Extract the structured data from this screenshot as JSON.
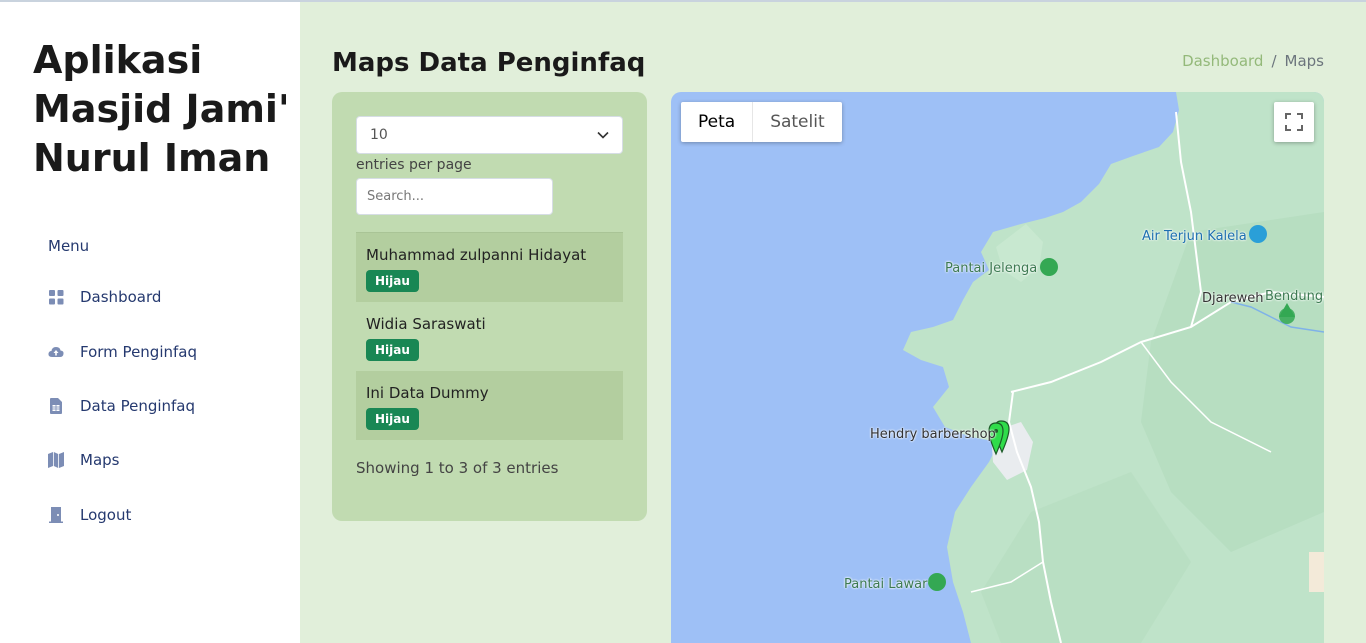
{
  "sidebar": {
    "app_title": "Aplikasi Masjid Jami' Nurul Iman",
    "menu_title": "Menu",
    "items": [
      {
        "label": "Dashboard",
        "icon": "grid-icon"
      },
      {
        "label": "Form Penginfaq",
        "icon": "cloud-upload-icon"
      },
      {
        "label": "Data Penginfaq",
        "icon": "spreadsheet-icon"
      },
      {
        "label": "Maps",
        "icon": "map-icon"
      },
      {
        "label": "Logout",
        "icon": "door-icon"
      }
    ]
  },
  "header": {
    "title": "Maps Data Penginfaq",
    "breadcrumb": [
      "Dashboard",
      "Maps"
    ],
    "breadcrumb_sep": "/"
  },
  "table": {
    "per_page_value": "10",
    "per_page_label": "entries per page",
    "search_placeholder": "Search...",
    "rows": [
      {
        "name": "Muhammad zulpanni Hidayat",
        "badge": "Hijau"
      },
      {
        "name": "Widia Saraswati",
        "badge": "Hijau"
      },
      {
        "name": "Ini Data Dummy",
        "badge": "Hijau"
      }
    ],
    "info": "Showing 1 to 3 of 3 entries"
  },
  "map": {
    "type_buttons": [
      "Peta",
      "Satelit"
    ],
    "labels": {
      "air_terjun": "Air Terjun Kalela",
      "pantai_jelenga": "Pantai Jelenga",
      "djareweh": "Djareweh",
      "bendunga": "Bendunga",
      "hendry": "Hendry barbershop",
      "pantai_lawar": "Pantai Lawar"
    }
  },
  "colors": {
    "sidebar_bg": "#ffffff",
    "page_bg": "#e1efda",
    "card_bg": "#c1dbb1",
    "badge_bg": "#198754",
    "breadcrumb_link": "#94b97a",
    "water": "#9ec0f6",
    "land": "#bfe3c9"
  }
}
